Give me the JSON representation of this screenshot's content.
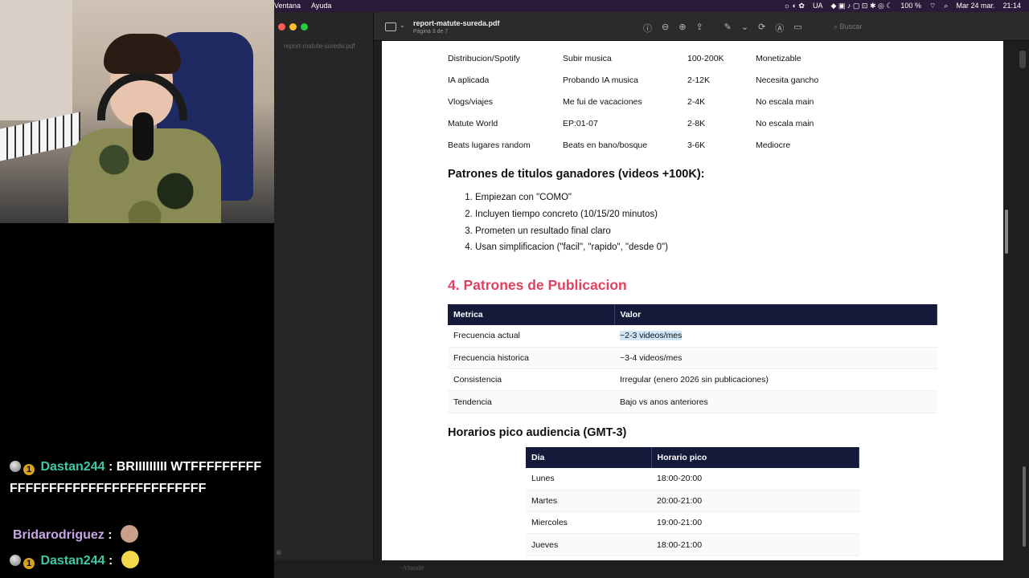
{
  "chat": {
    "messages": [
      {
        "user": "Dastan244",
        "text": "BRIIIIIIIII WTFFFFFFFFFFFFFFFFFFFFFFFFFFFFFFFFFF"
      },
      {
        "user": "Bridarodriguez",
        "text": ""
      },
      {
        "user": "Dastan244",
        "text": ""
      }
    ],
    "sub_badge": "1",
    "separator": ":"
  },
  "menubar": {
    "items": [
      "Ventana",
      "Ayuda"
    ],
    "status": [
      "UA",
      "100 %",
      "Mar 24 mar.",
      "21:14"
    ]
  },
  "viewer": {
    "sidebar_file": "report-matute-sureda.pdf",
    "title": "report-matute-sureda.pdf",
    "page_indicator": "Página 3 de 7",
    "search_placeholder": "Buscar",
    "terminal_label": "~/claude"
  },
  "doc": {
    "top_rows": [
      [
        "Distribucion/Spotify",
        "Subir musica",
        "100-200K",
        "Monetizable"
      ],
      [
        "IA aplicada",
        "Probando IA musica",
        "2-12K",
        "Necesita gancho"
      ],
      [
        "Vlogs/viajes",
        "Me fui de vacaciones",
        "2-4K",
        "No escala main"
      ],
      [
        "Matute World",
        "EP:01-07",
        "2-8K",
        "No escala main"
      ],
      [
        "Beats lugares random",
        "Beats en bano/bosque",
        "3-6K",
        "Mediocre"
      ]
    ],
    "patterns_heading": "Patrones de titulos ganadores (videos +100K):",
    "patterns": [
      "Empiezan con \"COMO\"",
      "Incluyen tiempo concreto (10/15/20 minutos)",
      "Prometen un resultado final claro",
      "Usan simplificacion (\"facil\", \"rapido\", \"desde 0\")"
    ],
    "section4_heading": "4. Patrones de Publicacion",
    "pub_table": {
      "headers": [
        "Metrica",
        "Valor"
      ],
      "rows": [
        [
          "Frecuencia actual",
          "~2-3 videos/mes"
        ],
        [
          "Frecuencia historica",
          "~3-4 videos/mes"
        ],
        [
          "Consistencia",
          "Irregular (enero 2026 sin publicaciones)"
        ],
        [
          "Tendencia",
          "Bajo vs anos anteriores"
        ]
      ]
    },
    "hours_heading": "Horarios pico audiencia (GMT-3)",
    "hours_table": {
      "headers": [
        "Dia",
        "Horario pico"
      ],
      "rows": [
        [
          "Lunes",
          "18:00-20:00"
        ],
        [
          "Martes",
          "20:00-21:00"
        ],
        [
          "Miercoles",
          "19:00-21:00"
        ],
        [
          "Jueves",
          "18:00-21:00"
        ]
      ]
    }
  }
}
